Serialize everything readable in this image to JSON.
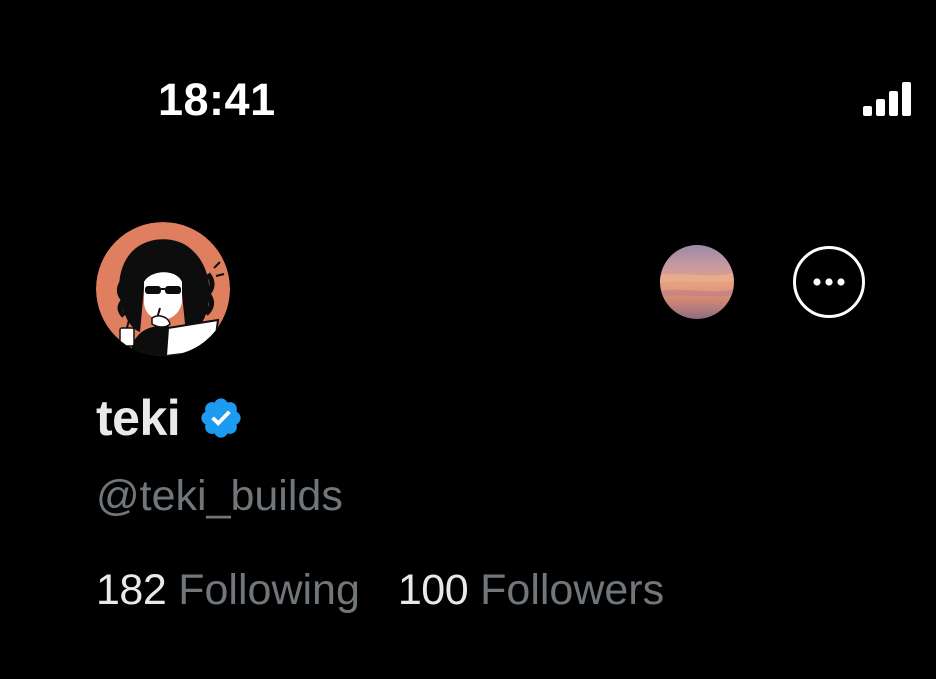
{
  "status_bar": {
    "time": "18:41",
    "signal_icon": "cellular-signal-icon"
  },
  "profile": {
    "avatar_icon": "profile-avatar-illustration",
    "display_name": "teki",
    "verified_icon": "verified-badge-icon",
    "handle": "@teki_builds",
    "stats": [
      {
        "count": "182",
        "label": "Following"
      },
      {
        "count": "100",
        "label": "Followers"
      }
    ]
  },
  "actions": {
    "blend_icon": "sunset-avatar-button",
    "more_icon": "more-options-icon"
  },
  "colors": {
    "background": "#000000",
    "primary_text": "#e7e9ea",
    "secondary_text": "#71767b",
    "verified_blue": "#1d9bf0",
    "avatar_bg": "#e07f5f"
  }
}
